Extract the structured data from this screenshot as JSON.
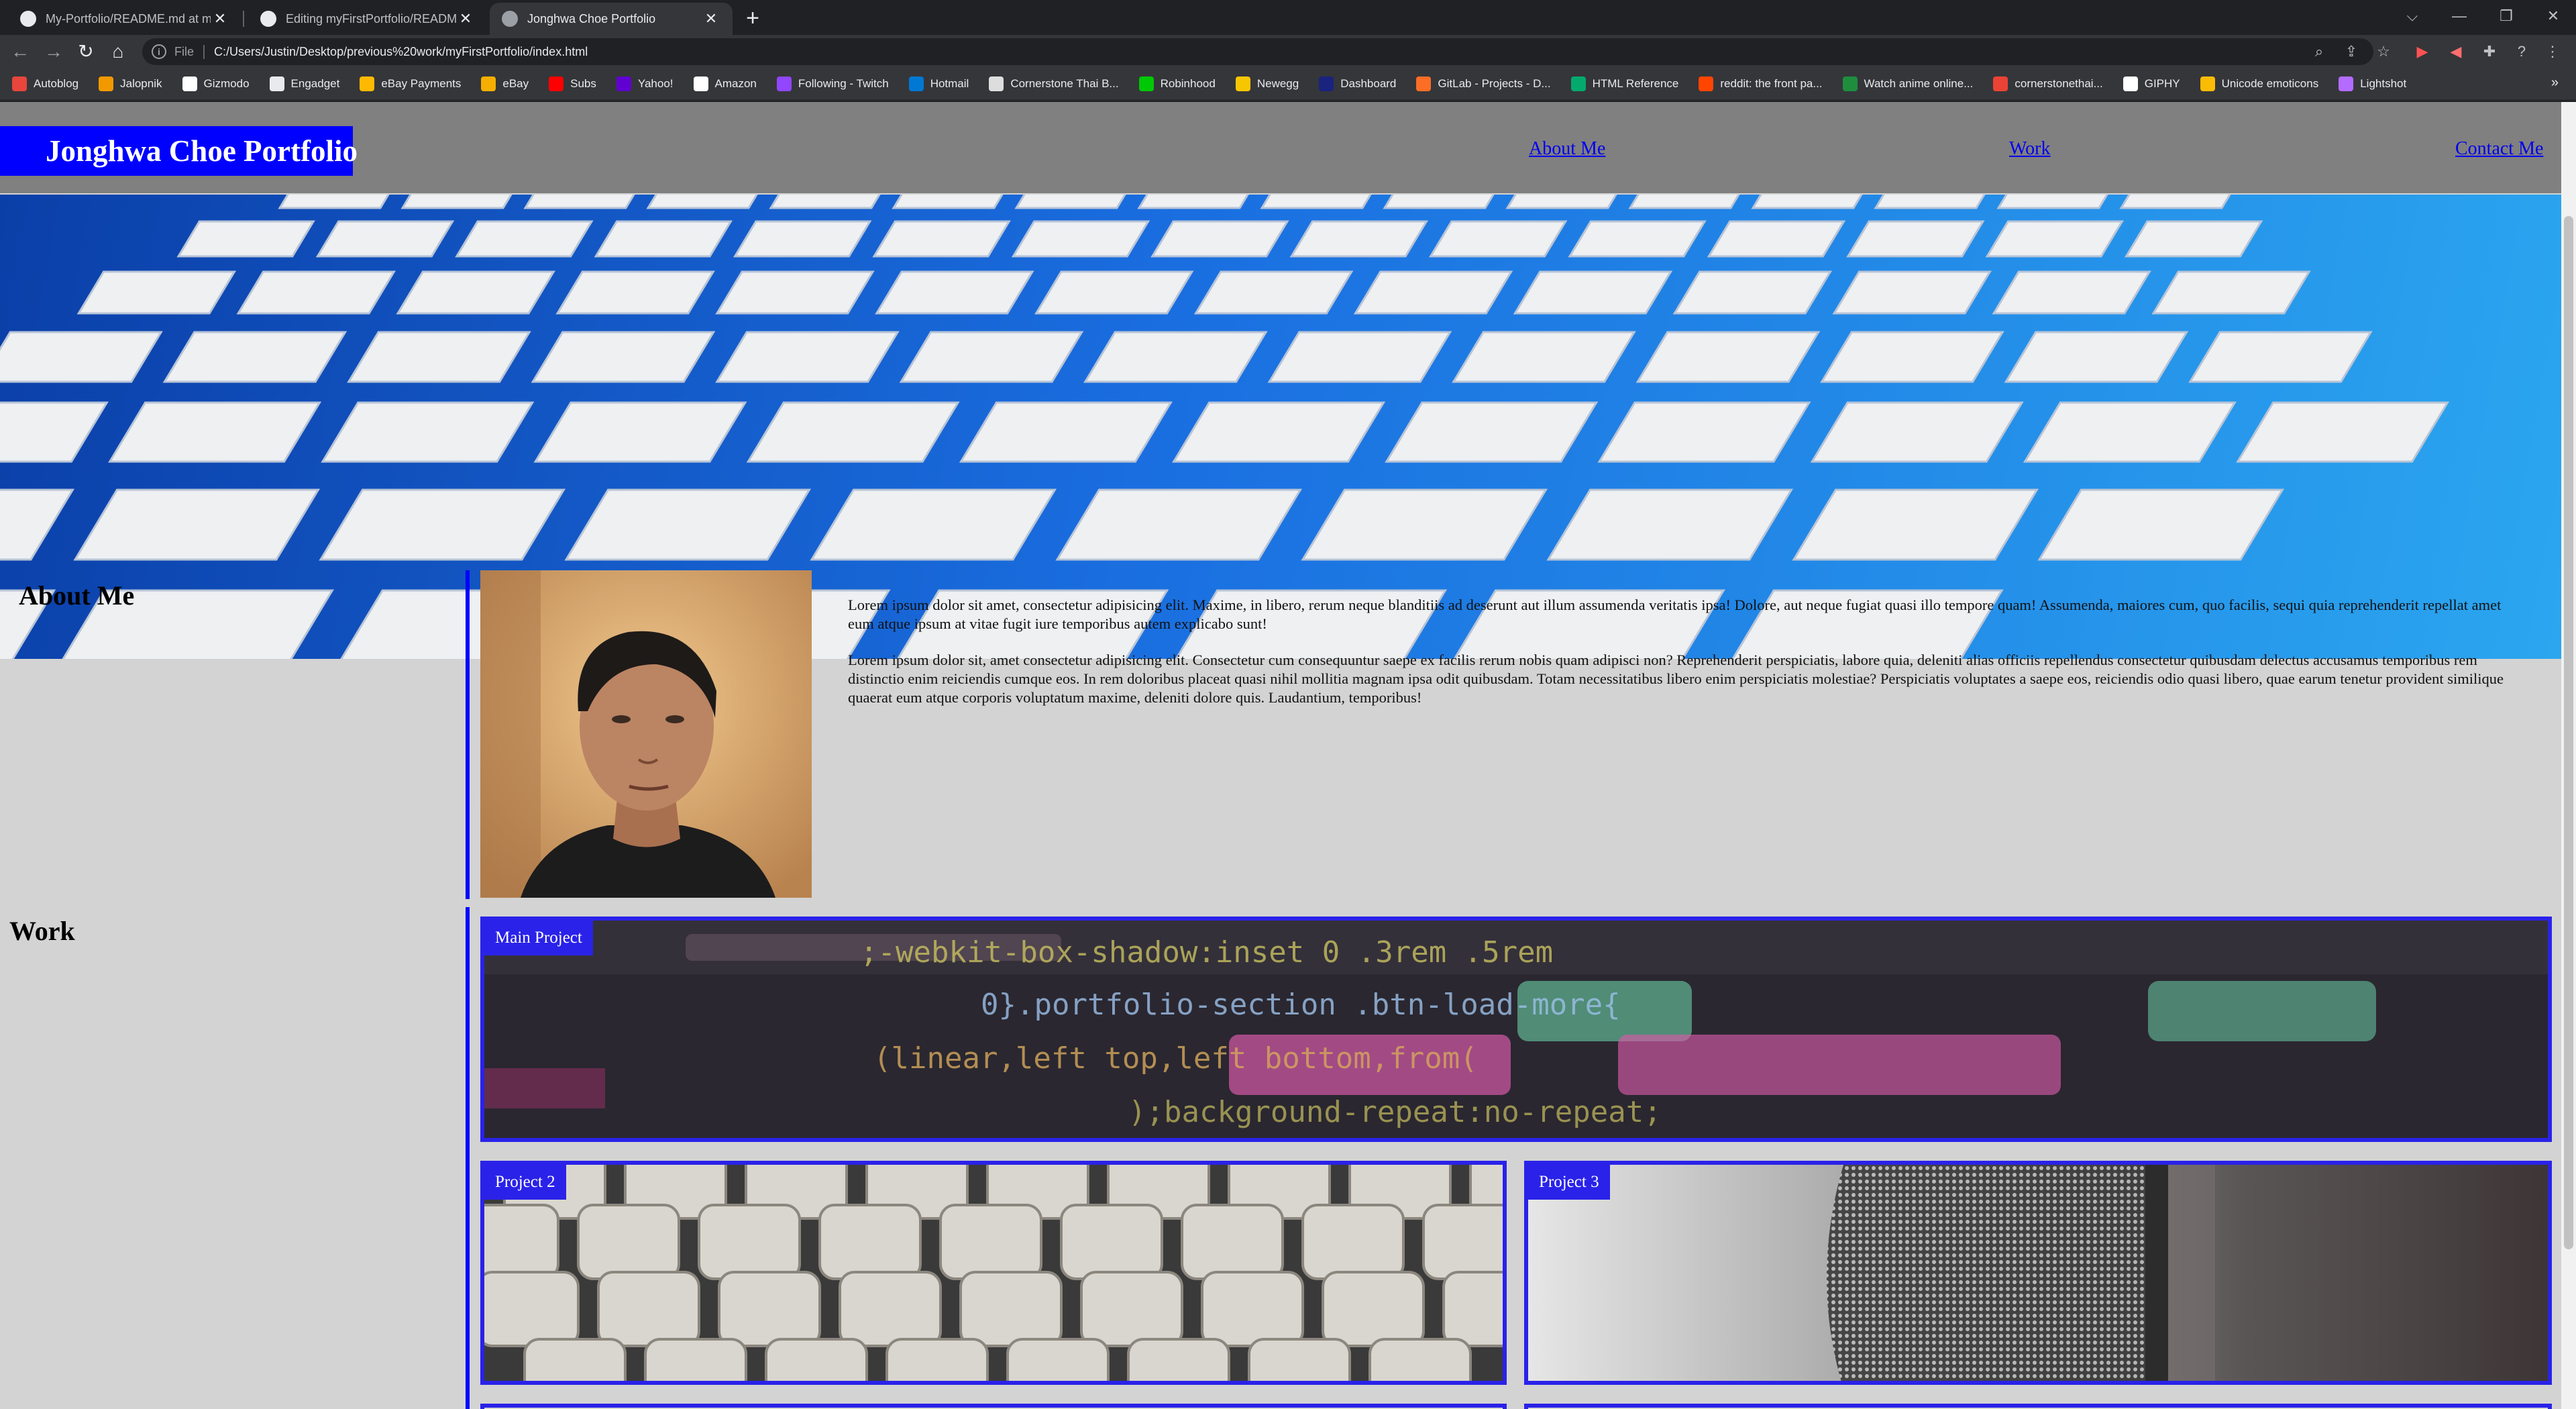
{
  "browser": {
    "tabs": [
      {
        "title": "My-Portfolio/README.md at main",
        "active": false
      },
      {
        "title": "Editing myFirstPortfolio/README.md",
        "active": false
      },
      {
        "title": "Jonghwa Choe Portfolio",
        "active": true
      }
    ],
    "new_tab_label": "+",
    "window_controls": {
      "tab_search": "⌵",
      "minimize": "—",
      "restore": "❐",
      "close": "✕"
    },
    "omnibox": {
      "scheme_label": "File",
      "url": "C:/Users/Justin/Desktop/previous%20work/myFirstPortfolio/index.html"
    },
    "bookmarks": [
      {
        "label": "Autoblog",
        "color": "#e8453c"
      },
      {
        "label": "Jalopnik",
        "color": "#f29900"
      },
      {
        "label": "Gizmodo",
        "color": "#ffffff"
      },
      {
        "label": "Engadget",
        "color": "#e8eaed"
      },
      {
        "label": "eBay Payments",
        "color": "#ffb900"
      },
      {
        "label": "eBay",
        "color": "#f5af02"
      },
      {
        "label": "Subs",
        "color": "#ff0000"
      },
      {
        "label": "Yahoo!",
        "color": "#6001d2"
      },
      {
        "label": "Amazon",
        "color": "#ffffff"
      },
      {
        "label": "Following - Twitch",
        "color": "#9146ff"
      },
      {
        "label": "Hotmail",
        "color": "#0078d4"
      },
      {
        "label": "Cornerstone Thai B...",
        "color": "#dddddd"
      },
      {
        "label": "Robinhood",
        "color": "#00c805"
      },
      {
        "label": "Newegg",
        "color": "#f7c600"
      },
      {
        "label": "Dashboard",
        "color": "#1a237e"
      },
      {
        "label": "GitLab - Projects - D...",
        "color": "#fc6d26"
      },
      {
        "label": "HTML Reference",
        "color": "#04aa6d"
      },
      {
        "label": "reddit: the front pa...",
        "color": "#ff4500"
      },
      {
        "label": "Watch anime online...",
        "color": "#1e8e3e"
      },
      {
        "label": "cornerstonethai...",
        "color": "#ea4335"
      },
      {
        "label": "GIPHY",
        "color": "#ffffff"
      },
      {
        "label": "Unicode emoticons",
        "color": "#fbbc04"
      },
      {
        "label": "Lightshot",
        "color": "#b36cff"
      }
    ],
    "bookmarks_more": "»"
  },
  "site": {
    "title": "Jonghwa Choe Portfolio",
    "nav": {
      "about": "About Me",
      "work": "Work",
      "contact": "Contact Me"
    },
    "about": {
      "heading": "About Me",
      "paragraph1": "Lorem ipsum dolor sit amet, consectetur adipisicing elit. Maxime, in libero, rerum neque blanditiis ad deserunt aut illum assumenda veritatis ipsa! Dolore, aut neque fugiat quasi illo tempore quam! Assumenda, maiores cum, quo facilis, sequi quia reprehenderit repellat amet eum atque ipsum at vitae fugit iure temporibus autem explicabo sunt!",
      "paragraph2": "Lorem ipsum dolor sit, amet consectetur adipisicing elit. Consectetur cum consequuntur saepe ex facilis rerum nobis quam adipisci non? Reprehenderit perspiciatis, labore quia, deleniti alias officiis repellendus consectetur quibusdam delectus accusamus temporibus rem distinctio enim reiciendis cumque eos. In rem doloribus placeat quasi nihil mollitia magnam ipsa odit quibusdam. Totam necessitatibus libero enim perspiciatis molestiae? Perspiciatis voluptates a saepe eos, reiciendis odio quasi libero, quae earum tenetur provident similique quaerat eum atque corporis voluptatum maxime, deleniti dolore quis. Laudantium, temporibus!"
    },
    "work": {
      "heading": "Work",
      "projects": [
        {
          "label": "Main Project"
        },
        {
          "label": "Project 2"
        },
        {
          "label": "Project 3"
        }
      ]
    },
    "colors": {
      "accent": "#0000ff",
      "header_bg": "#808080",
      "page_bg": "#d3d3d3",
      "link": "#0000ee"
    }
  }
}
